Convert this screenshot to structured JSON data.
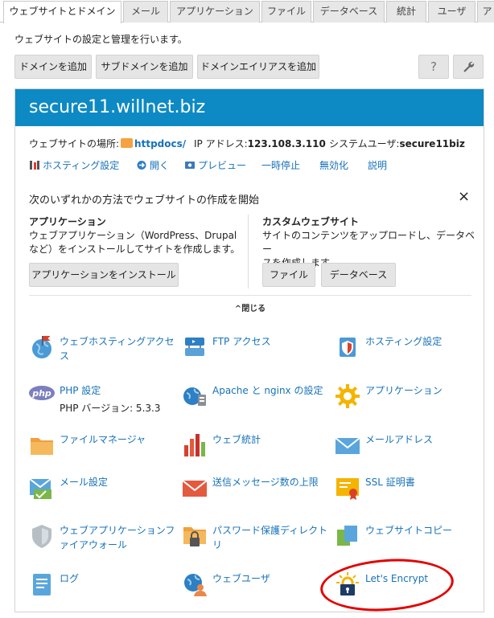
{
  "tabs": [
    {
      "label": "ウェブサイトとドメイン",
      "active": true
    },
    {
      "label": "メール"
    },
    {
      "label": "アプリケーション"
    },
    {
      "label": "ファイル"
    },
    {
      "label": "データベース"
    },
    {
      "label": "統計"
    },
    {
      "label": "ユーザ"
    },
    {
      "label": "ア"
    }
  ],
  "intro": "ウェブサイトの設定と管理を行います。",
  "toolbar": {
    "add_domain": "ドメインを追加",
    "add_subdomain": "サブドメインを追加",
    "add_alias": "ドメインエイリアスを追加",
    "help": "?",
    "tools_icon": "wrench-icon"
  },
  "site": {
    "domain": "secure11.willnet.biz",
    "location_label": "ウェブサイトの場所:",
    "location_value": "httpdocs/",
    "ip_label": "IP アドレス:",
    "ip_value": "123.108.3.110",
    "sysuser_label": "システムユーザ:",
    "sysuser_value": "secure11biz",
    "accent_color": "#0d8ac4"
  },
  "actions": [
    {
      "label": "ホスティング設定",
      "icon": "hosting-tools-icon"
    },
    {
      "label": "開く",
      "icon": "open-icon"
    },
    {
      "label": "プレビュー",
      "icon": "preview-icon"
    },
    {
      "label": "一時停止"
    },
    {
      "label": "無効化"
    },
    {
      "label": "説明"
    }
  ],
  "create": {
    "title": "次のいずれかの方法でウェブサイトの作成を開始",
    "close": "×",
    "app_title": "アプリケーション",
    "app_desc_1": "ウェブアプリケーション（WordPress、Drupal",
    "app_desc_2": "など）をインストールしてサイトを作成します。",
    "app_button": "アプリケーションをインストール",
    "custom_title": "カスタムウェブサイト",
    "custom_desc_1": "サイトのコンテンツをアップロードし、データベー",
    "custom_desc_2": "スを作成します。",
    "files_button": "ファイル",
    "db_button": "データベース",
    "collapse": "閉じる"
  },
  "grid": [
    {
      "label": "ウェブホスティングアクセス",
      "icon": "globe-flag-icon"
    },
    {
      "label": "FTP アクセス",
      "icon": "ftp-icon"
    },
    {
      "label": "ホスティング設定",
      "icon": "hosting-settings-icon"
    },
    {
      "label": "PHP 設定",
      "sub": "PHP バージョン: 5.3.3",
      "icon": "php-icon"
    },
    {
      "label": "Apache と nginx の設定",
      "icon": "apache-icon"
    },
    {
      "label": "アプリケーション",
      "icon": "gear-icon"
    },
    {
      "label": "ファイルマネージャ",
      "icon": "folder-icon"
    },
    {
      "label": "ウェブ統計",
      "icon": "bar-chart-icon"
    },
    {
      "label": "メールアドレス",
      "icon": "envelope-icon"
    },
    {
      "label": "メール設定",
      "icon": "mail-settings-icon"
    },
    {
      "label": "送信メッセージ数の上限",
      "icon": "mail-limit-icon"
    },
    {
      "label": "SSL 証明書",
      "icon": "certificate-icon"
    },
    {
      "label": "ウェブアプリケーションファイアウォール",
      "icon": "shield-icon"
    },
    {
      "label": "パスワード保護ディレクトリ",
      "icon": "locked-folder-icon"
    },
    {
      "label": "ウェブサイトコピー",
      "icon": "copy-icon"
    },
    {
      "label": "ログ",
      "icon": "log-icon"
    },
    {
      "label": "ウェブユーザ",
      "icon": "web-user-icon"
    },
    {
      "label": "Let's Encrypt",
      "icon": "lets-encrypt-icon"
    }
  ]
}
